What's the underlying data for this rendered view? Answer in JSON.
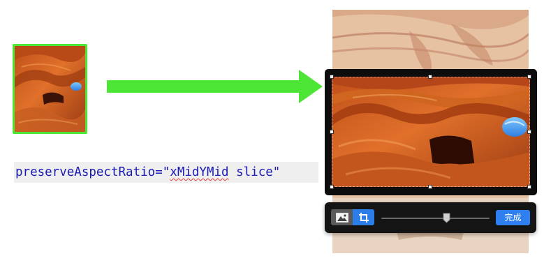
{
  "code_caption": {
    "attr": "preserveAspectRatio",
    "equals": "=",
    "quote_open": "\"",
    "value_word": "xMidYMid",
    "value_rest": " slice",
    "quote_close": "\""
  },
  "toolbar": {
    "image_mode_icon": "image-icon",
    "crop_mode_icon": "crop-icon",
    "done_label": "完成",
    "zoom_level": 0.6
  },
  "colors": {
    "arrow_green": "#4ee636",
    "toolbar_bg": "#141414",
    "accent_blue": "#2f7ff0",
    "code_text": "#1a1ab4",
    "code_bg": "#efefef"
  }
}
